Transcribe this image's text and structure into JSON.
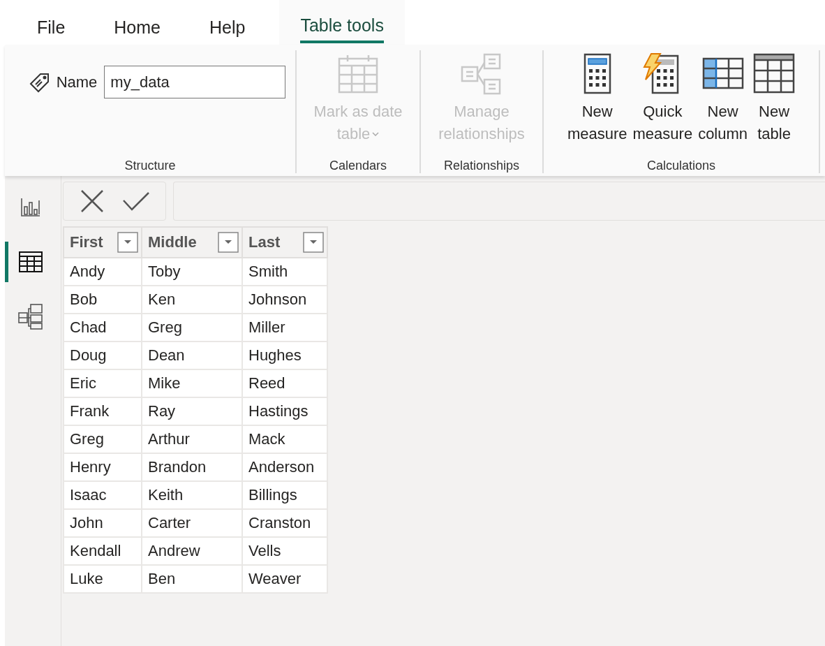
{
  "menu": [
    {
      "label": "File",
      "selected": false
    },
    {
      "label": "Home",
      "selected": false
    },
    {
      "label": "Help",
      "selected": false
    },
    {
      "label": "Table tools",
      "selected": true
    }
  ],
  "ribbon": {
    "groups": [
      {
        "title": "Structure",
        "kind": "name",
        "label": "Name",
        "value": "my_data"
      },
      {
        "title": "Calendars",
        "kind": "buttons",
        "buttons": [
          {
            "lines": [
              "Mark as date",
              "table"
            ],
            "disabled": true,
            "dropdown": true
          }
        ]
      },
      {
        "title": "Relationships",
        "kind": "buttons",
        "buttons": [
          {
            "lines": [
              "Manage",
              "relationships"
            ],
            "disabled": true,
            "dropdown": false
          }
        ]
      },
      {
        "title": "Calculations",
        "kind": "buttons",
        "buttons": [
          {
            "lines": [
              "New",
              "measure"
            ],
            "disabled": false,
            "dropdown": false
          },
          {
            "lines": [
              "Quick",
              "measure"
            ],
            "disabled": false,
            "dropdown": false
          },
          {
            "lines": [
              "New",
              "column"
            ],
            "disabled": false,
            "dropdown": false
          },
          {
            "lines": [
              "New",
              "table"
            ],
            "disabled": false,
            "dropdown": false
          }
        ]
      }
    ]
  },
  "views": [
    {
      "selected": false
    },
    {
      "selected": true
    },
    {
      "selected": false
    }
  ],
  "table": {
    "columns": [
      "First",
      "Middle",
      "Last"
    ],
    "rows": [
      [
        "Andy",
        "Toby",
        "Smith"
      ],
      [
        "Bob",
        "Ken",
        "Johnson"
      ],
      [
        "Chad",
        "Greg",
        "Miller"
      ],
      [
        "Doug",
        "Dean",
        "Hughes"
      ],
      [
        "Eric",
        "Mike",
        "Reed"
      ],
      [
        "Frank",
        "Ray",
        "Hastings"
      ],
      [
        "Greg",
        "Arthur",
        "Mack"
      ],
      [
        "Henry",
        "Brandon",
        "Anderson"
      ],
      [
        "Isaac",
        "Keith",
        "Billings"
      ],
      [
        "John",
        "Carter",
        "Cranston"
      ],
      [
        "Kendall",
        "Andrew",
        "Vells"
      ],
      [
        "Luke",
        "Ben",
        "Weaver"
      ]
    ]
  }
}
